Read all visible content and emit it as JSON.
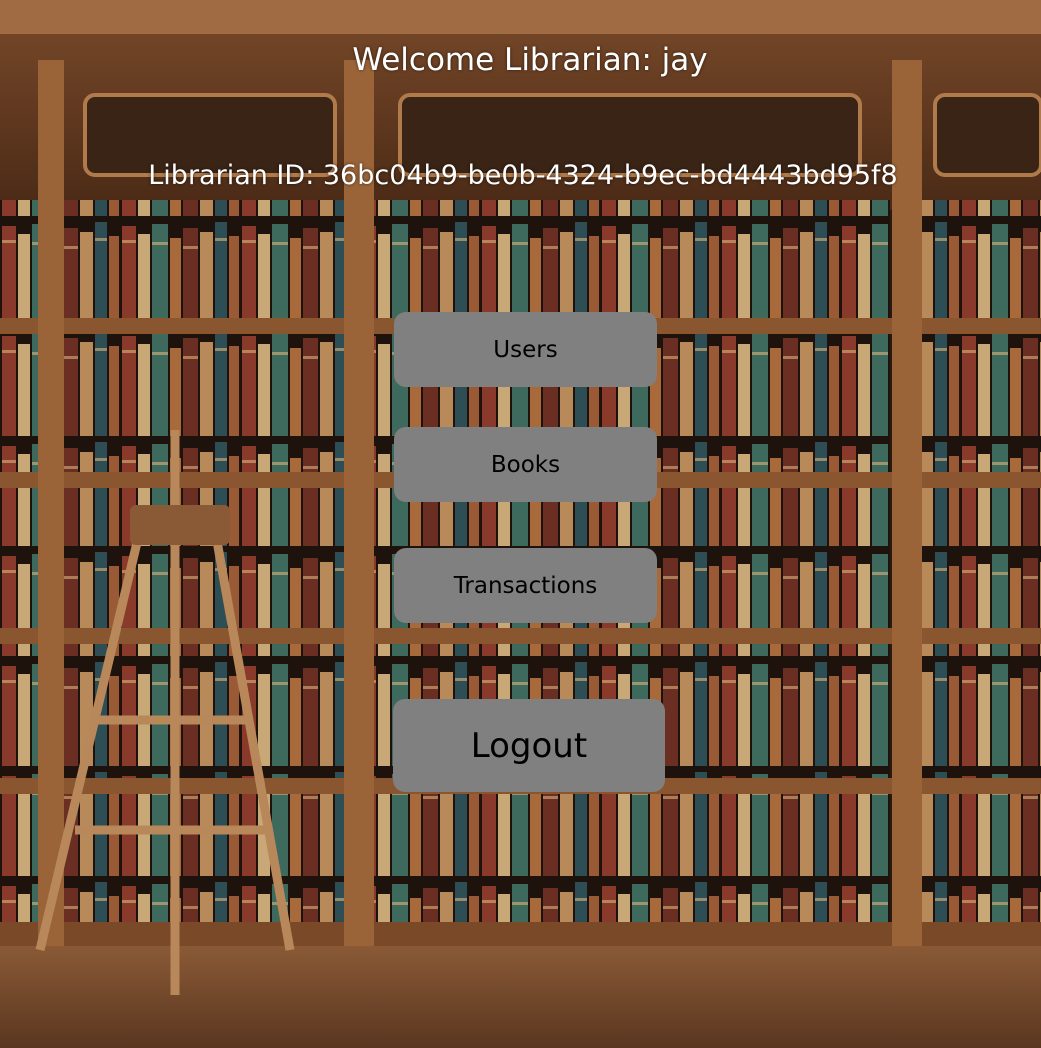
{
  "header": {
    "welcome_text": "Welcome Librarian: jay",
    "librarian_id_text": "Librarian ID: 36bc04b9-be0b-4324-b9ec-bd4443bd95f8"
  },
  "menu": {
    "users_label": "Users",
    "books_label": "Books",
    "transactions_label": "Transactions",
    "logout_label": "Logout"
  },
  "colors": {
    "button_bg": "#808080",
    "text_light": "#ffffff",
    "text_dark": "#000000"
  }
}
